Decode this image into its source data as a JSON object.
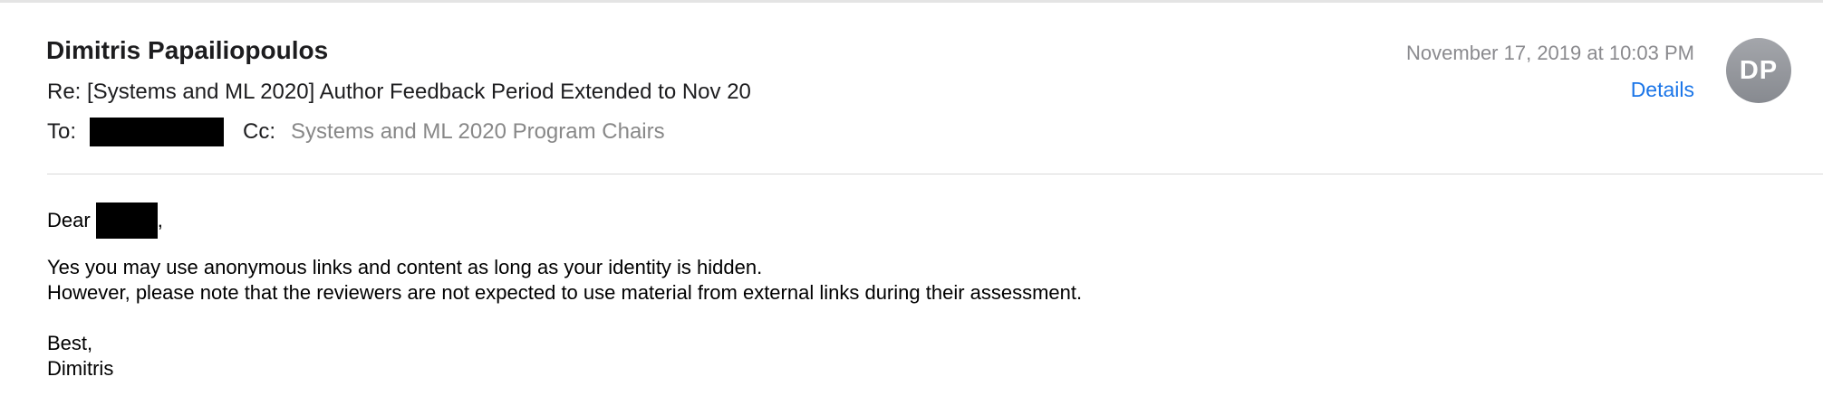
{
  "header": {
    "sender_name": "Dimitris Papailiopoulos",
    "subject": "Re: [Systems and ML 2020] Author Feedback Period Extended to Nov 20",
    "to_label": "To:",
    "cc_label": "Cc:",
    "cc_value": "Systems and ML 2020 Program Chairs",
    "date": "November 17, 2019 at 10:03 PM",
    "details_label": "Details",
    "avatar_initials": "DP"
  },
  "message": {
    "greeting_prefix": "Dear",
    "greeting_suffix": ",",
    "line1": "Yes you may use anonymous links and content as long as your identity is hidden.",
    "line2": "However, please note that the reviewers are not expected to use material from external links during their assessment.",
    "closing": "Best,",
    "signature": "Dimitris"
  },
  "colors": {
    "link": "#1a75e8",
    "secondary_text": "#8a8a8e",
    "avatar_bg": "#949499",
    "redaction": "#000000"
  }
}
